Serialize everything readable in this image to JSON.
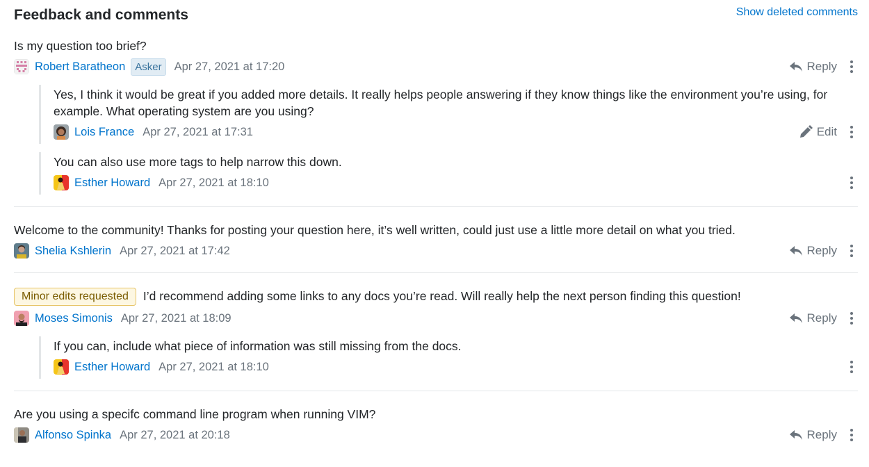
{
  "header": {
    "title": "Feedback and comments",
    "show_deleted": "Show deleted comments"
  },
  "actions": {
    "reply": "Reply",
    "edit": "Edit"
  },
  "threads": [
    {
      "body": "Is my question too brief?",
      "author": "Robert Baratheon",
      "badge": "Asker",
      "timestamp": "Apr 27, 2021 at 17:20",
      "replies": [
        {
          "body": "Yes, I think it would be great if you added more details. It really helps people answering if they know things like the environment you’re using, for example. What operating system are you using?",
          "author": "Lois France",
          "timestamp": "Apr 27, 2021 at 17:31"
        },
        {
          "body": "You can also use more tags to help narrow this down.",
          "author": "Esther Howard",
          "timestamp": "Apr 27, 2021 at 18:10"
        }
      ]
    },
    {
      "body": "Welcome to the community! Thanks for posting your question here, it’s well written, could just use a little more detail on what you tried.",
      "author": "Shelia Kshlerin",
      "timestamp": "Apr 27, 2021 at 17:42"
    },
    {
      "tag": "Minor edits requested",
      "body": "I’d recommend adding some links to any docs you’re read. Will really help the next person finding this question!",
      "author": "Moses Simonis",
      "timestamp": "Apr 27, 2021 at 18:09",
      "replies": [
        {
          "body": "If you can, include what piece of information was still missing from the docs.",
          "author": "Esther Howard",
          "timestamp": "Apr 27, 2021 at 18:10"
        }
      ]
    },
    {
      "body": "Are you using a specifc command line program when running VIM?",
      "author": "Alfonso Spinka",
      "timestamp": "Apr 27, 2021 at 20:18"
    }
  ],
  "colors": {
    "link": "#0074cc",
    "muted": "#6a737c",
    "asker_badge_bg": "#e1ecf4",
    "minor_badge_bg": "#fdf7e2",
    "minor_badge_border": "#e6c365"
  }
}
